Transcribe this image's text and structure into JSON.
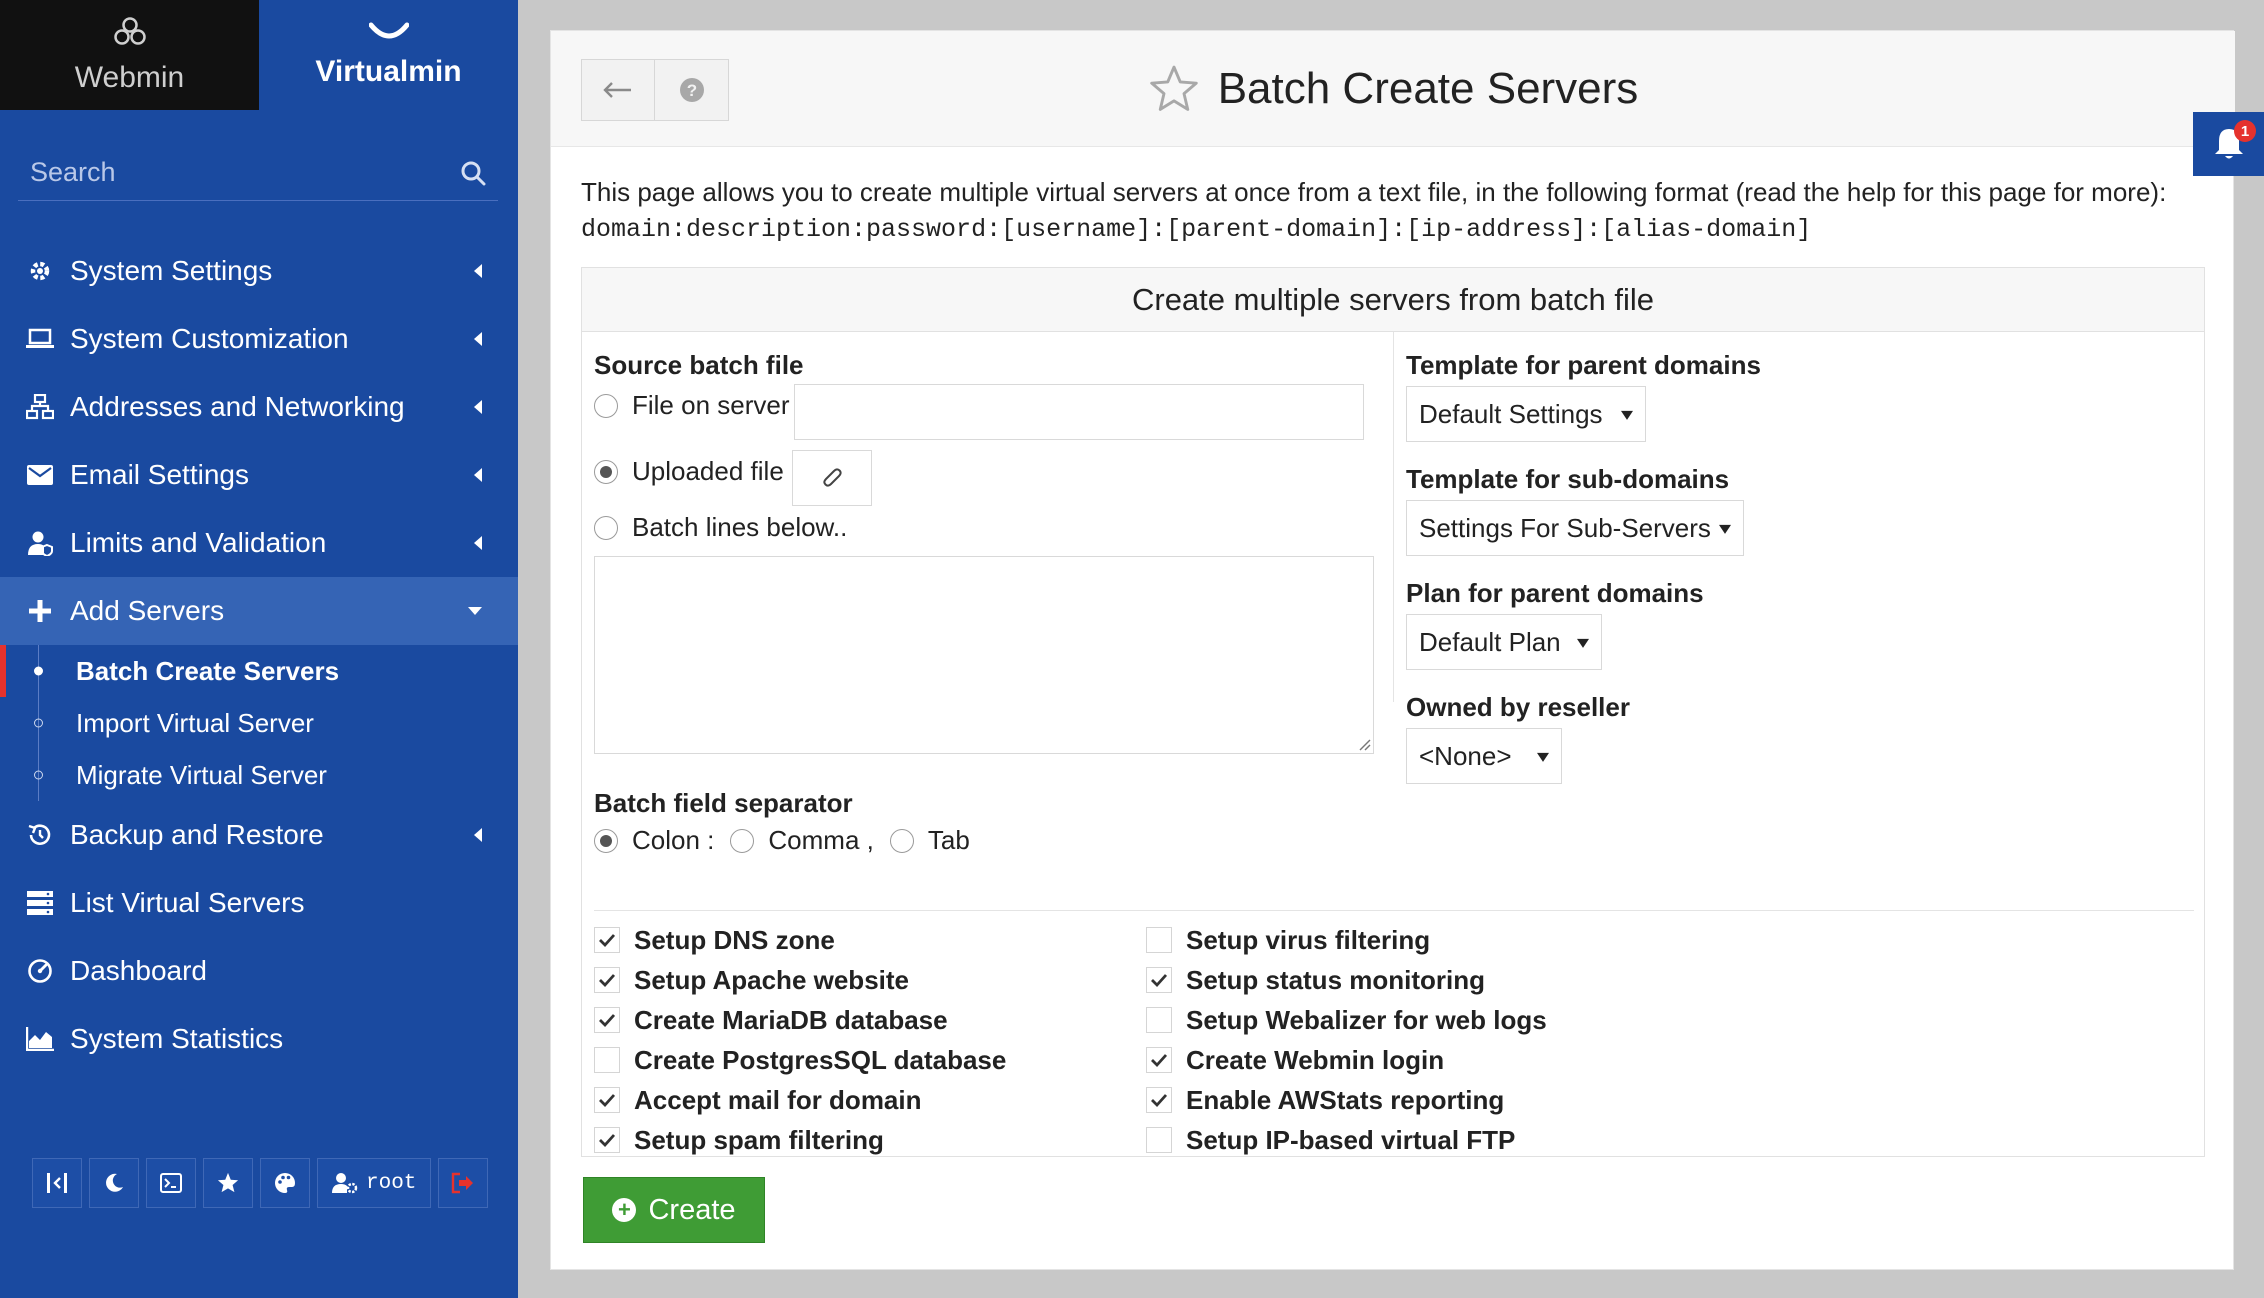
{
  "switcher": {
    "webmin": "Webmin",
    "virtualmin": "Virtualmin"
  },
  "search": {
    "placeholder": "Search"
  },
  "nav": {
    "system_settings": "System Settings",
    "system_customization": "System Customization",
    "addresses_networking": "Addresses and Networking",
    "email_settings": "Email Settings",
    "limits_validation": "Limits and Validation",
    "add_servers": "Add Servers",
    "sub": [
      "Batch Create Servers",
      "Import Virtual Server",
      "Migrate Virtual Server"
    ],
    "backup_restore": "Backup and Restore",
    "list_virtual_servers": "List Virtual Servers",
    "dashboard": "Dashboard",
    "system_statistics": "System Statistics"
  },
  "bottombar": {
    "user": "root"
  },
  "page": {
    "title": "Batch Create Servers",
    "intro": "This page allows you to create multiple virtual servers at once from a text file, in the following format (read the help for this page for more):",
    "format": "domain:description:password:[username]:[parent-domain]:[ip-address]:[alias-domain]"
  },
  "form": {
    "header": "Create multiple servers from batch file",
    "source_label": "Source batch file",
    "file_on_server": "File on server",
    "uploaded_file": "Uploaded file",
    "batch_lines": "Batch lines below..",
    "separator_label": "Batch field separator",
    "sep_colon": "Colon :",
    "sep_comma": "Comma ,",
    "sep_tab": "Tab",
    "template_parent_label": "Template for parent domains",
    "template_parent_value": "Default Settings",
    "template_sub_label": "Template for sub-domains",
    "template_sub_value": "Settings For Sub-Servers",
    "plan_label": "Plan for parent domains",
    "plan_value": "Default Plan",
    "reseller_label": "Owned by reseller",
    "reseller_value": "<None>"
  },
  "options_left": [
    {
      "label": "Setup DNS zone",
      "checked": true
    },
    {
      "label": "Setup Apache website",
      "checked": true
    },
    {
      "label": "Create MariaDB database",
      "checked": true
    },
    {
      "label": "Create PostgresSQL database",
      "checked": false
    },
    {
      "label": "Accept mail for domain",
      "checked": true
    },
    {
      "label": "Setup spam filtering",
      "checked": true
    }
  ],
  "options_right": [
    {
      "label": "Setup virus filtering",
      "checked": false
    },
    {
      "label": "Setup status monitoring",
      "checked": true
    },
    {
      "label": "Setup Webalizer for web logs",
      "checked": false
    },
    {
      "label": "Create Webmin login",
      "checked": true
    },
    {
      "label": "Enable AWStats reporting",
      "checked": true
    },
    {
      "label": "Setup IP-based virtual FTP",
      "checked": false
    }
  ],
  "actions": {
    "create": "Create"
  },
  "notifications": {
    "count": "1"
  }
}
